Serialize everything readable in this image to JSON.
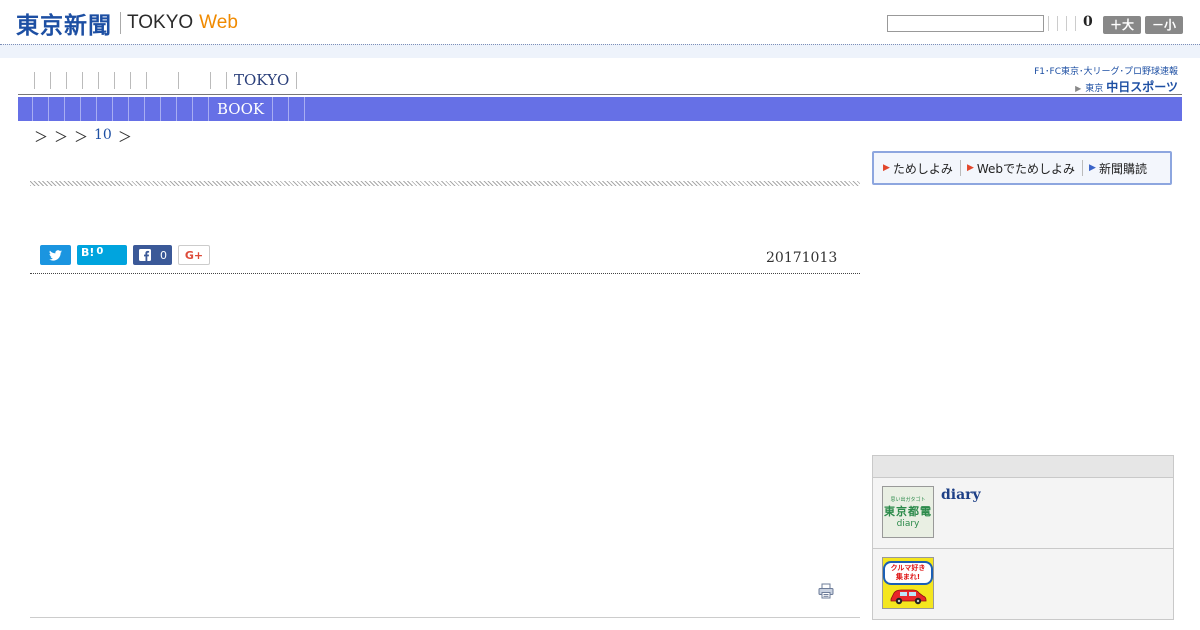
{
  "header": {
    "logo_ja": "東京新聞",
    "logo_en": "TOKYO",
    "logo_web": "Web",
    "count": "0",
    "size_large": "＋大",
    "size_small": "－小"
  },
  "gnav": {
    "tokyo_label": "TOKYO",
    "chunichi_top": "F1･FC東京･大リーグ･プロ野球速報",
    "chunichi_small": "東京",
    "chunichi_main": "中日スポーツ"
  },
  "section_bar": {
    "book_label": "BOOK"
  },
  "breadcrumb": {
    "sep1": "＞",
    "sep2": "＞",
    "sep3": "＞",
    "link": "10",
    "sep4": "＞"
  },
  "share": {
    "hatena_label": "B!",
    "hatena_count": "0",
    "facebook_count": "0",
    "google_label": "G+"
  },
  "article": {
    "date": "20171013"
  },
  "subscribe": {
    "trial": "ためしよみ",
    "web_trial": "Webでためしよみ",
    "subscribe": "新聞購読"
  },
  "side_panel": {
    "items": [
      {
        "title": "diary",
        "thumb_small": "思い出ガタゴト",
        "thumb_main": "東京都電",
        "thumb_sub": "diary"
      },
      {
        "title": "",
        "thumb_main": "クルマ好き集まれ!"
      }
    ]
  },
  "colors": {
    "brand_blue": "#1d4fa3",
    "section_bar": "#6670e6",
    "web_orange": "#f08a00"
  }
}
